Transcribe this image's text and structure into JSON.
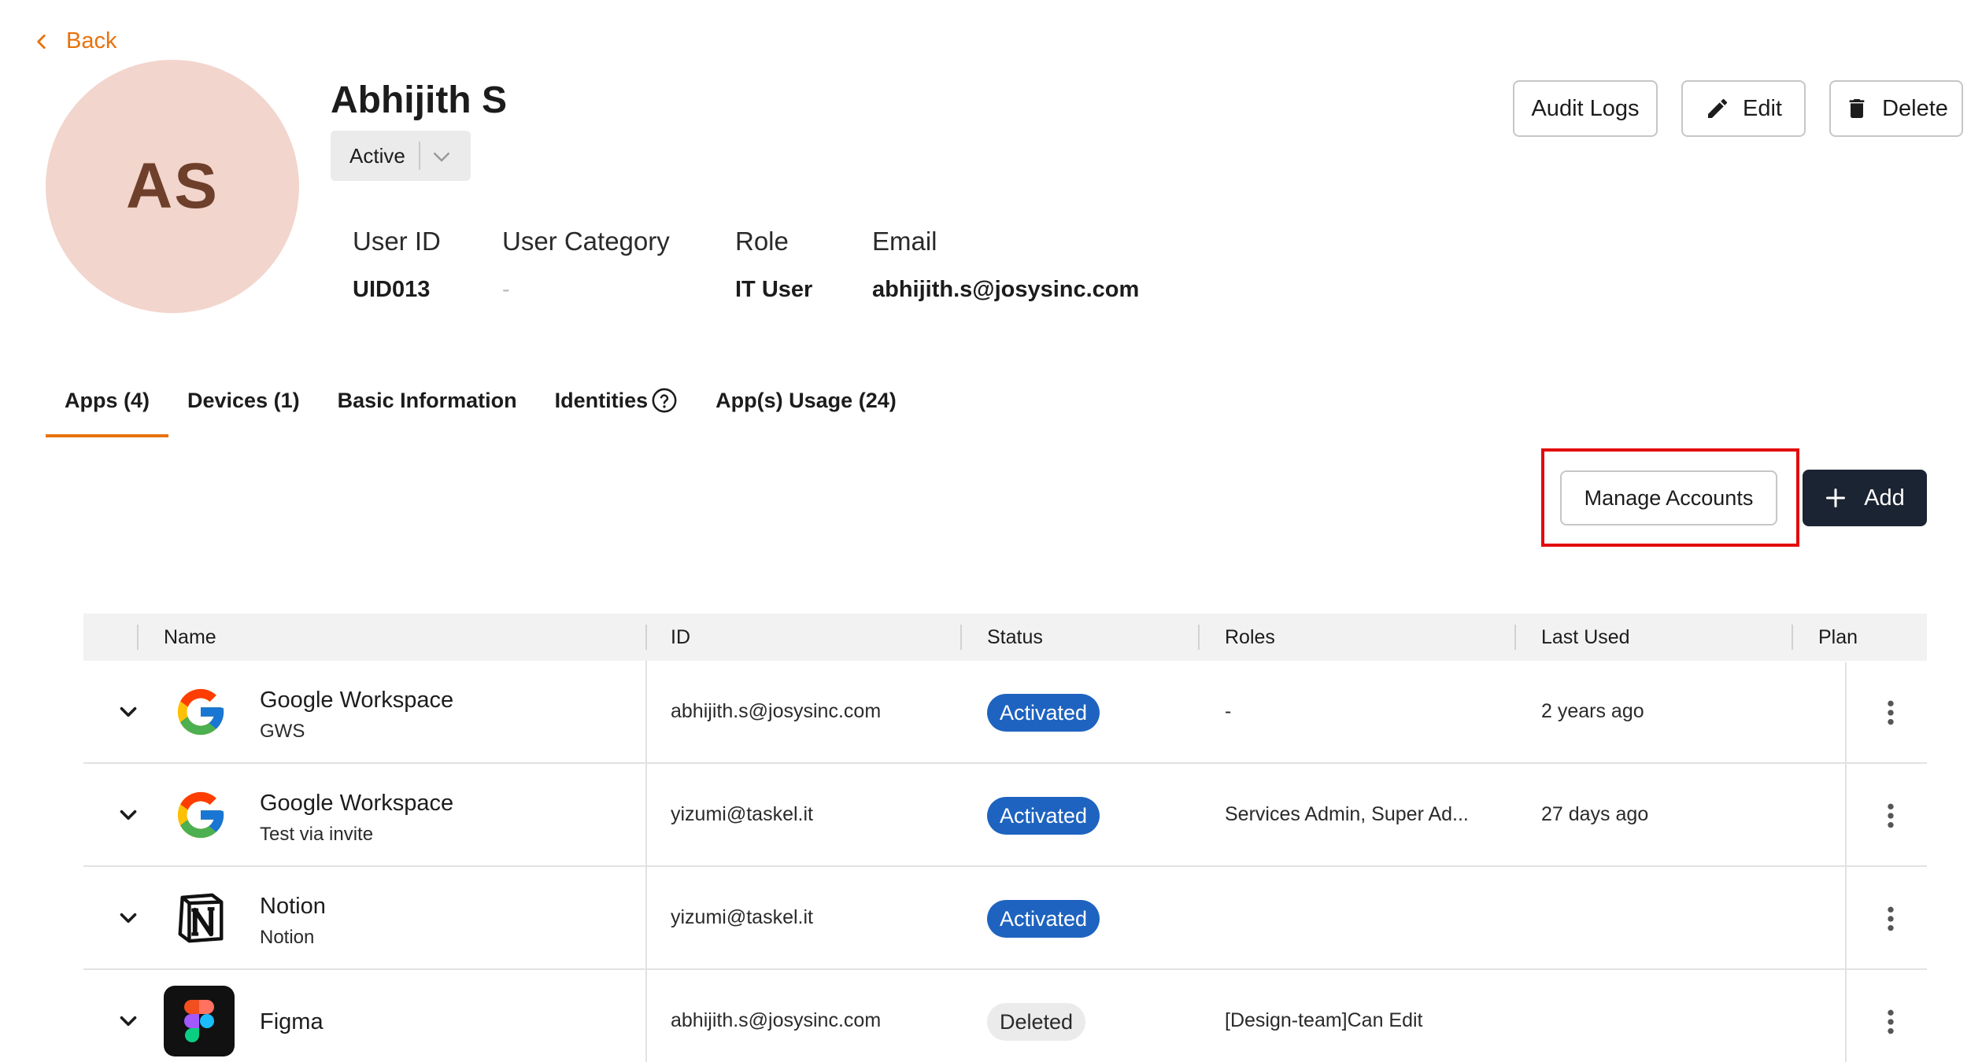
{
  "back_label": "Back",
  "user": {
    "initials": "AS",
    "name": "Abhijith S",
    "status": "Active"
  },
  "info": {
    "labels": {
      "user_id": "User ID",
      "category": "User Category",
      "role": "Role",
      "email": "Email"
    },
    "values": {
      "user_id": "UID013",
      "category": "-",
      "role": "IT User",
      "email": "abhijith.s@josysinc.com"
    }
  },
  "actions": {
    "audit_logs": "Audit Logs",
    "edit": "Edit",
    "delete": "Delete"
  },
  "tabs": [
    {
      "label": "Apps (4)",
      "active": true
    },
    {
      "label": "Devices (1)"
    },
    {
      "label": "Basic Information"
    },
    {
      "label": "Identities"
    },
    {
      "label": "App(s) Usage (24)"
    }
  ],
  "toolbar": {
    "manage_accounts": "Manage Accounts",
    "add": "Add"
  },
  "table": {
    "headers": {
      "name": "Name",
      "id": "ID",
      "status": "Status",
      "roles": "Roles",
      "last_used": "Last Used",
      "plan": "Plan"
    },
    "rows": [
      {
        "logo": "google-logo",
        "name": "Google Workspace",
        "sub": "GWS",
        "id": "abhijith.s@josysinc.com",
        "status": "Activated",
        "roles": "-",
        "last_used": "2 years ago"
      },
      {
        "logo": "google-logo",
        "name": "Google Workspace",
        "sub": "Test via invite",
        "id": "yizumi@taskel.it",
        "status": "Activated",
        "roles": "Services Admin, Super Ad...",
        "last_used": "27 days ago"
      },
      {
        "logo": "notion-logo",
        "name": "Notion",
        "sub": "Notion",
        "id": "yizumi@taskel.it",
        "status": "Activated",
        "roles": "",
        "last_used": ""
      },
      {
        "logo": "figma-logo",
        "name": "Figma",
        "sub": "",
        "id": "abhijith.s@josysinc.com",
        "status": "Deleted",
        "roles": "[Design-team]Can Edit",
        "last_used": ""
      }
    ]
  },
  "colors": {
    "accent": "#e8720c",
    "status_active": "#1e63c0",
    "primary_button": "#1b2432",
    "highlight": "#e30b0b"
  }
}
